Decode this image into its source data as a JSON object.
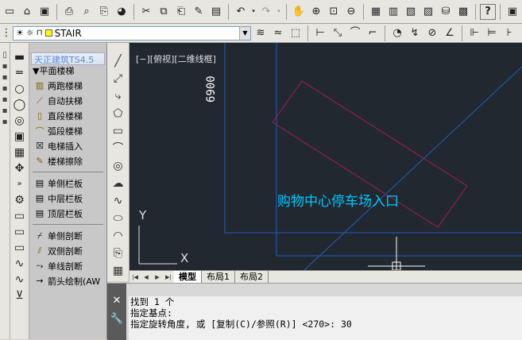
{
  "toolbar": {
    "layer_name": "STAIR"
  },
  "panel": {
    "title": "天正建筑TS4.5",
    "section": "▼平面楼梯",
    "items": [
      {
        "label": "两跑楼梯"
      },
      {
        "label": "自动扶梯"
      },
      {
        "label": "直段楼梯"
      },
      {
        "label": "弧段楼梯"
      },
      {
        "label": "电梯插入"
      },
      {
        "label": "楼梯擦除"
      },
      {
        "label": "单侧栏板"
      },
      {
        "label": "中层栏板"
      },
      {
        "label": "顶层栏板"
      },
      {
        "label": "单侧剖断"
      },
      {
        "label": "双侧剖断"
      },
      {
        "label": "单线剖断"
      },
      {
        "label": "箭头绘制(AW"
      }
    ]
  },
  "canvas": {
    "view_label": "[−][俯视][二维线框]",
    "dimension_text": "6900",
    "text_label": "购物中心停车场入口",
    "axis_y": "Y",
    "axis_x": "X"
  },
  "layout_tabs": {
    "model": "模型",
    "layout1": "布局1",
    "layout2": "布局2"
  },
  "command": {
    "line1": "找到 1 个",
    "line2": "指定基点:",
    "line3": "指定旋转角度, 或 [复制(C)/参照(R)] <270>: 30"
  },
  "colors": {
    "canvas_bg": "#212830",
    "blue_lines": "#1e5fbf",
    "magenta_rect": "#8c1f4a",
    "cyan_text": "#00c8ff"
  }
}
